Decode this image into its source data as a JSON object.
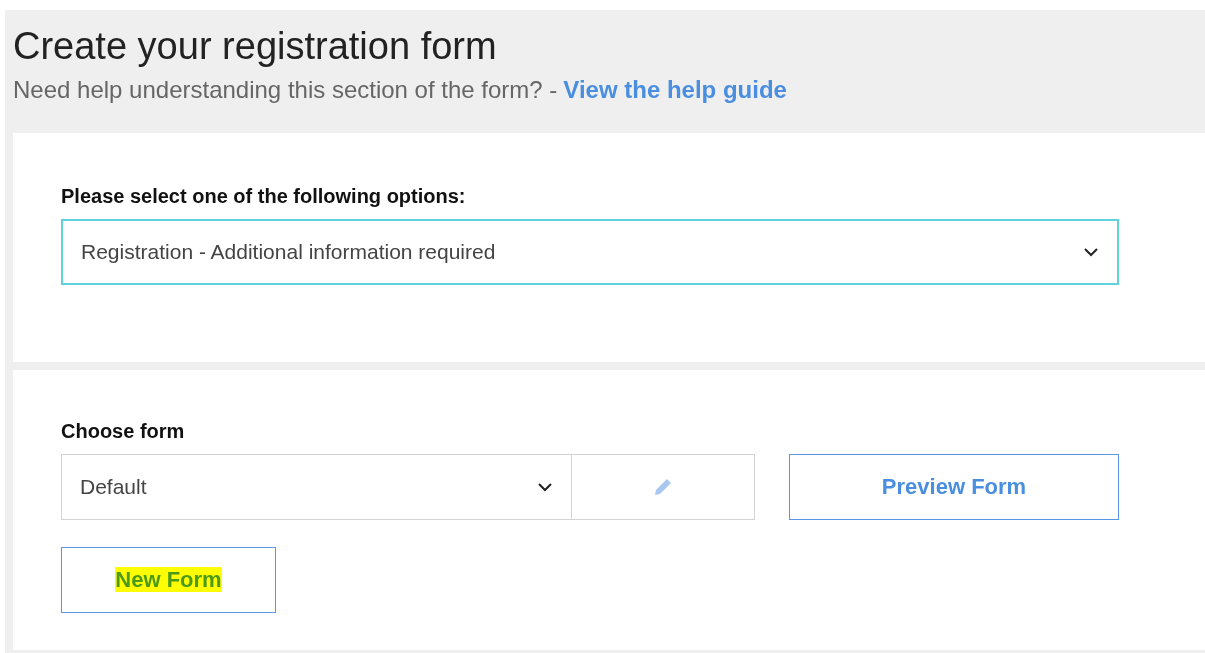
{
  "header": {
    "title": "Create your registration form",
    "help_text": "Need help understanding this section of the form? -",
    "help_link": "View the help guide"
  },
  "options_section": {
    "label": "Please select one of the following options:",
    "select": {
      "value": "Registration - Additional information required",
      "focused": true
    }
  },
  "form_section": {
    "label": "Choose form",
    "select": {
      "value": "Default",
      "focused": false
    },
    "edit_disabled": true,
    "buttons": [
      {
        "label": "Preview Form",
        "highlighted": false
      },
      {
        "label": "New Form",
        "highlighted": true
      }
    ]
  }
}
